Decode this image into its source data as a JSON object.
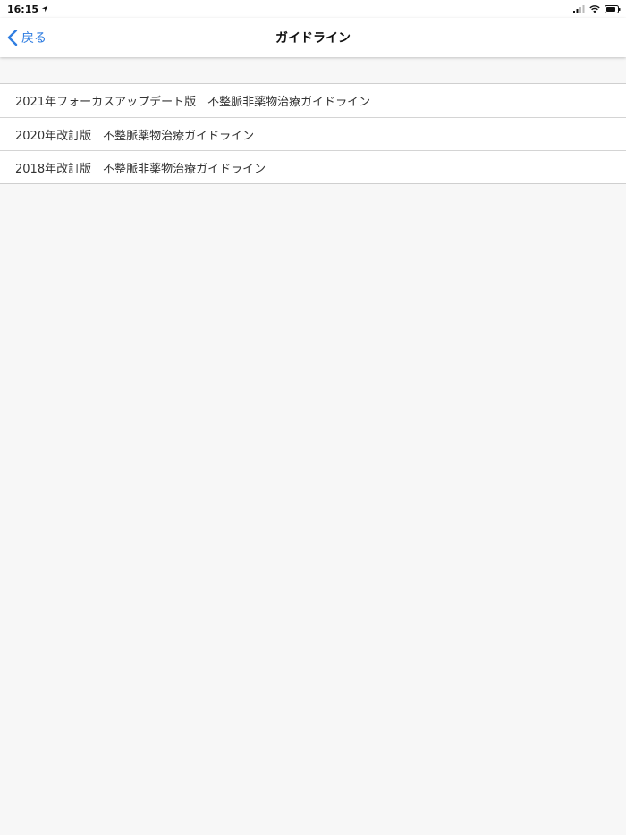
{
  "status_bar": {
    "time": "16:15",
    "icons": [
      "location-arrow-icon",
      "signal-icon",
      "wifi-icon",
      "battery-icon"
    ]
  },
  "nav_bar": {
    "back_label": "戻る",
    "title": "ガイドライン",
    "back_icon": "chevron-left-icon",
    "accent_color": "#2f7de1"
  },
  "guidelines": [
    {
      "label": "2021年フォーカスアップデート版　不整脈非薬物治療ガイドライン"
    },
    {
      "label": "2020年改訂版　不整脈薬物治療ガイドライン"
    },
    {
      "label": "2018年改訂版　不整脈非薬物治療ガイドライン"
    }
  ]
}
